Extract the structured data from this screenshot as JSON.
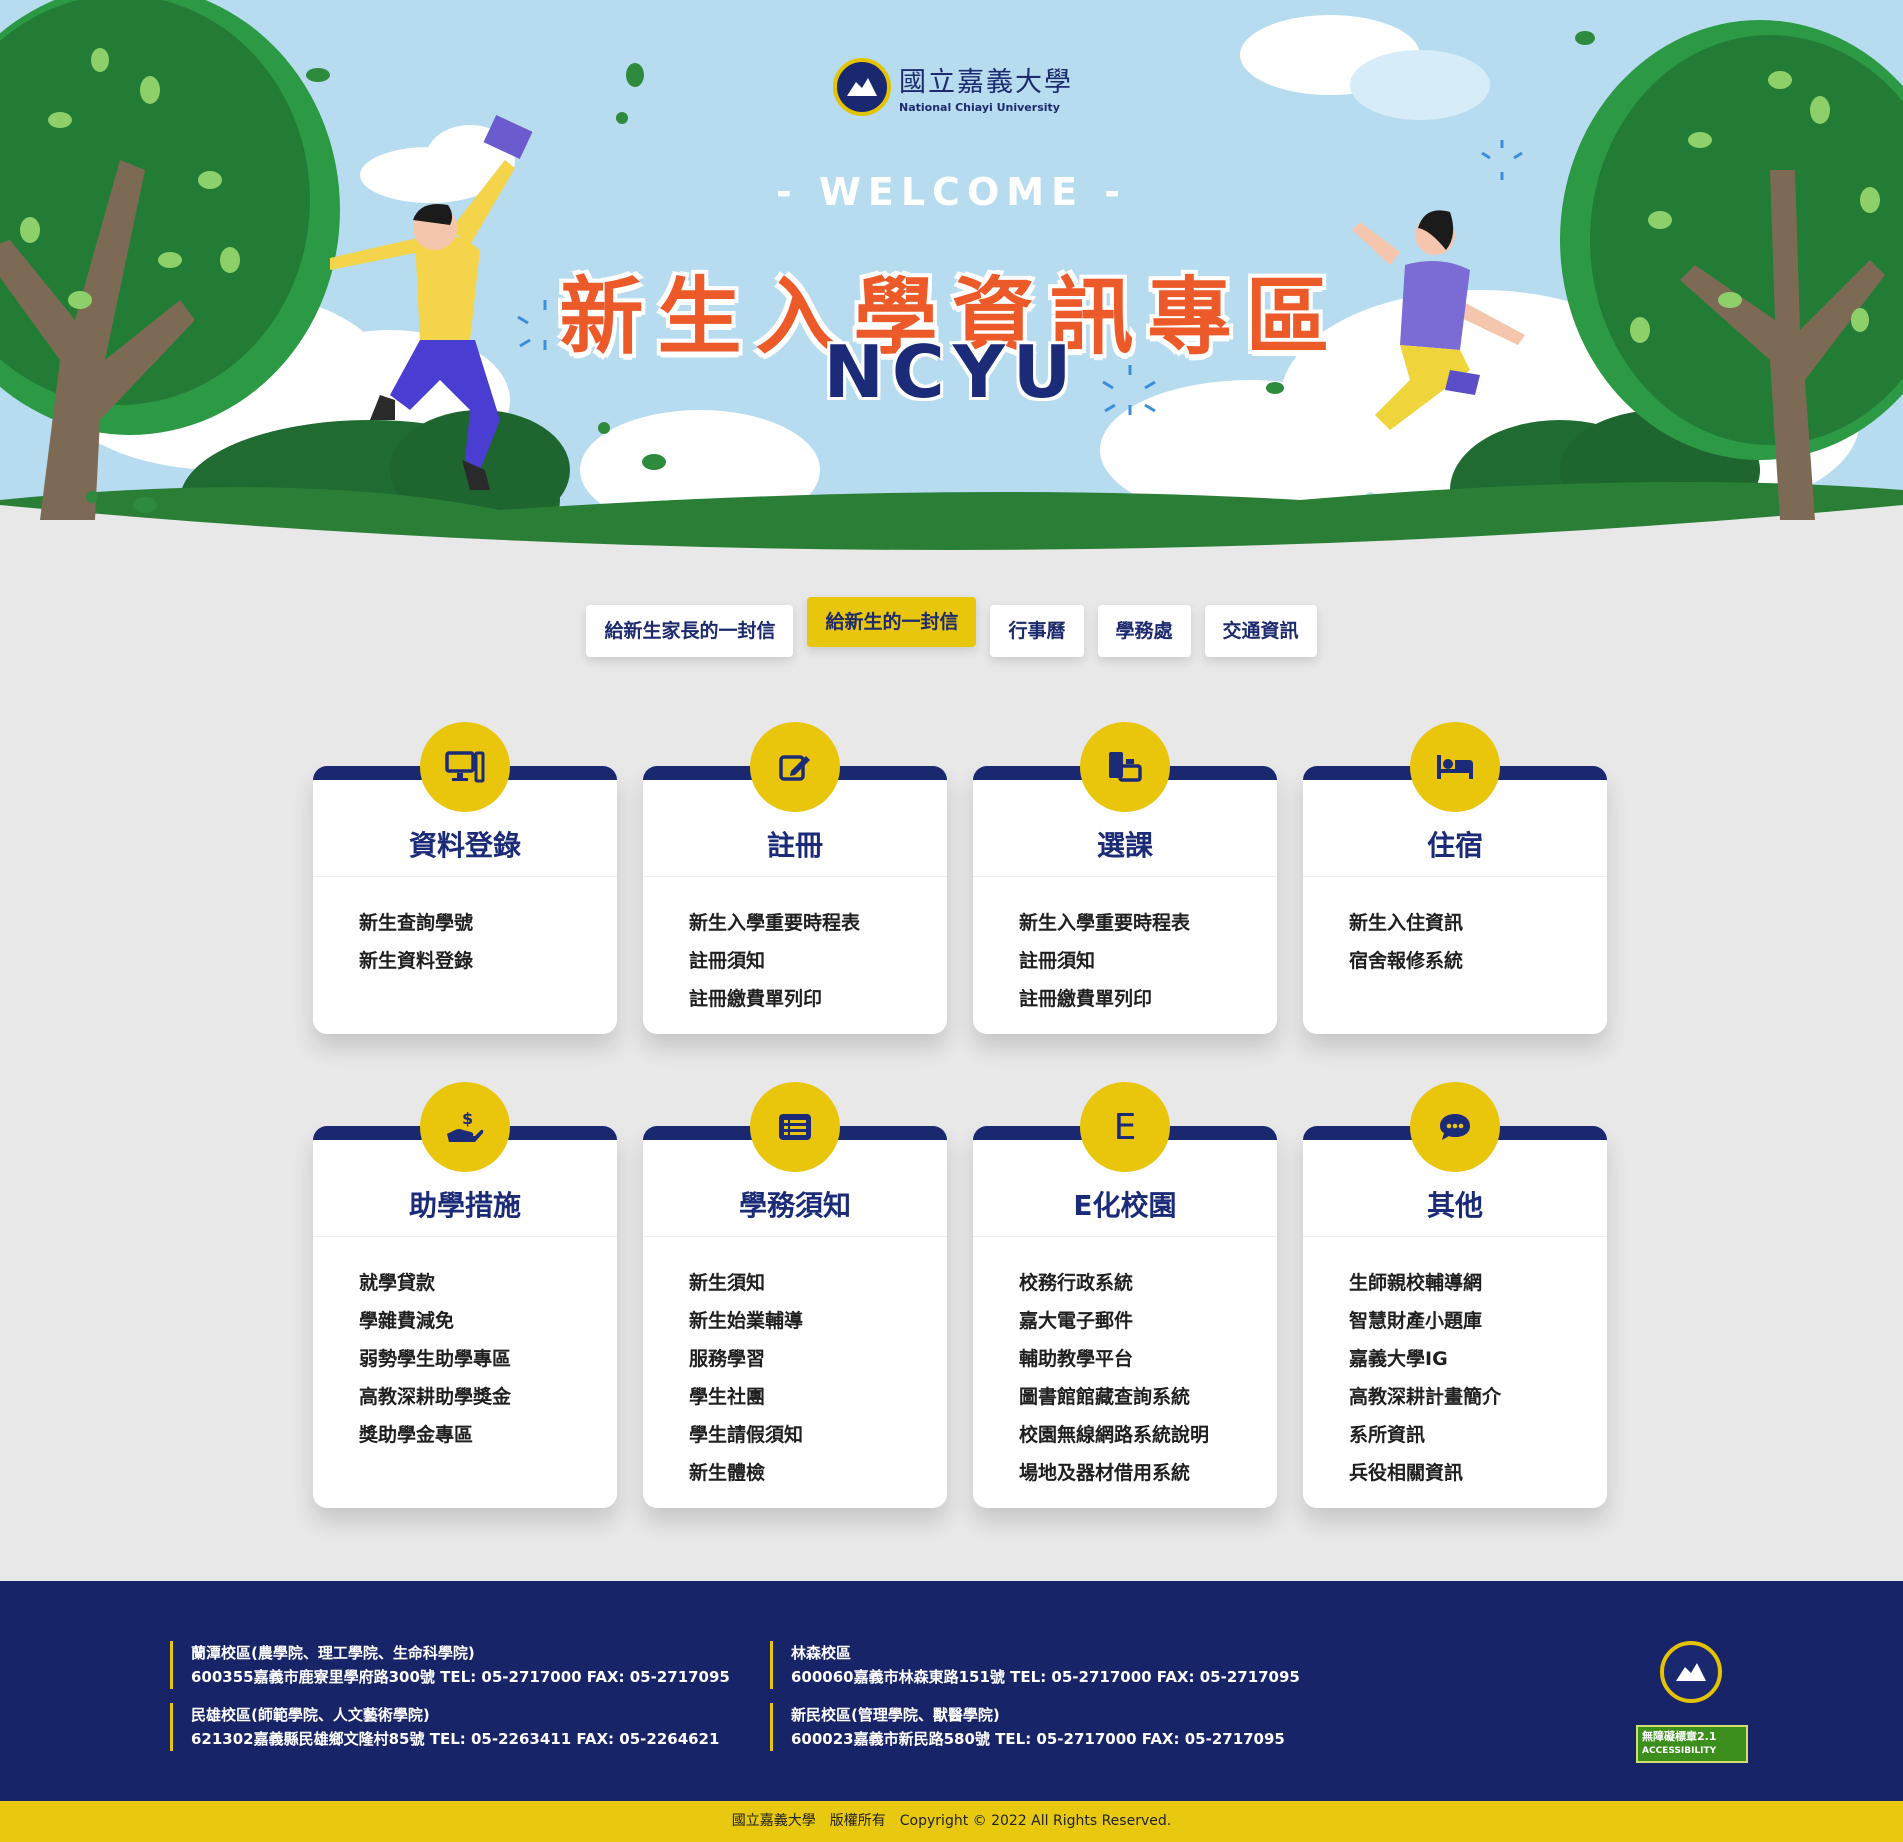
{
  "header": {
    "logo_zh": "國立嘉義大學",
    "logo_en": "National Chiayi University",
    "welcome": "- WELCOME -",
    "title": "新生入學資訊專區",
    "subtitle": "NCYU"
  },
  "tabs": [
    {
      "label": "給新生家長的一封信",
      "active": false
    },
    {
      "label": "給新生的一封信",
      "active": true
    },
    {
      "label": "行事曆",
      "active": false
    },
    {
      "label": "學務處",
      "active": false
    },
    {
      "label": "交通資訊",
      "active": false
    }
  ],
  "cards": [
    {
      "title": "資料登錄",
      "icon": "computer-icon",
      "items": [
        "新生查詢學號",
        "新生資料登錄"
      ]
    },
    {
      "title": "註冊",
      "icon": "edit-icon",
      "items": [
        "新生入學重要時程表",
        "註冊須知",
        "註冊繳費單列印"
      ]
    },
    {
      "title": "選課",
      "icon": "course-select-icon",
      "items": [
        "新生入學重要時程表",
        "註冊須知",
        "註冊繳費單列印"
      ]
    },
    {
      "title": "住宿",
      "icon": "bed-icon",
      "items": [
        "新生入住資訊",
        "宿舍報修系統"
      ]
    },
    {
      "title": "助學措施",
      "icon": "hand-money-icon",
      "items": [
        "就學貸款",
        "學雜費減免",
        "弱勢學生助學專區",
        "高教深耕助學獎金",
        "獎助學金專區"
      ]
    },
    {
      "title": "學務須知",
      "icon": "list-icon",
      "items": [
        "新生須知",
        "新生始業輔導",
        "服務學習",
        "學生社團",
        "學生請假須知",
        "新生體檢"
      ]
    },
    {
      "title": "E化校園",
      "icon": "letter-e-icon",
      "icon_text": "E",
      "items": [
        "校務行政系統",
        "嘉大電子郵件",
        "輔助教學平台",
        "圖書館館藏查詢系統",
        "校園無線網路系統說明",
        "場地及器材借用系統"
      ]
    },
    {
      "title": "其他",
      "icon": "chat-icon",
      "items": [
        "生師親校輔導網",
        "智慧財產小題庫",
        "嘉義大學IG",
        "高教深耕計畫簡介",
        "系所資訊",
        "兵役相關資訊"
      ]
    }
  ],
  "footer": {
    "campuses": [
      {
        "name": "蘭潭校區(農學院、理工學院、生命科學院)",
        "address": "600355嘉義市鹿寮里學府路300號 TEL: 05-2717000 FAX: 05-2717095"
      },
      {
        "name": "林森校區",
        "address": "600060嘉義市林森東路151號 TEL: 05-2717000 FAX: 05-2717095"
      },
      {
        "name": "民雄校區(師範學院、人文藝術學院)",
        "address": "621302嘉義縣民雄鄉文隆村85號 TEL: 05-2263411 FAX: 05-2264621"
      },
      {
        "name": "新民校區(管理學院、獸醫學院)",
        "address": "600023嘉義市新民路580號 TEL: 05-2717000 FAX: 05-2717095"
      }
    ],
    "accessibility_badge": "無障礙標章2.1",
    "accessibility_sub": "ACCESSIBILITY",
    "copyright": "國立嘉義大學　版權所有　Copyright © 2022 All Rights Reserved."
  },
  "colors": {
    "navy": "#1a2870",
    "yellow": "#e9c50b",
    "orange": "#ed5a2a",
    "sky": "#b7dcef",
    "green": "#2e8b3d"
  }
}
